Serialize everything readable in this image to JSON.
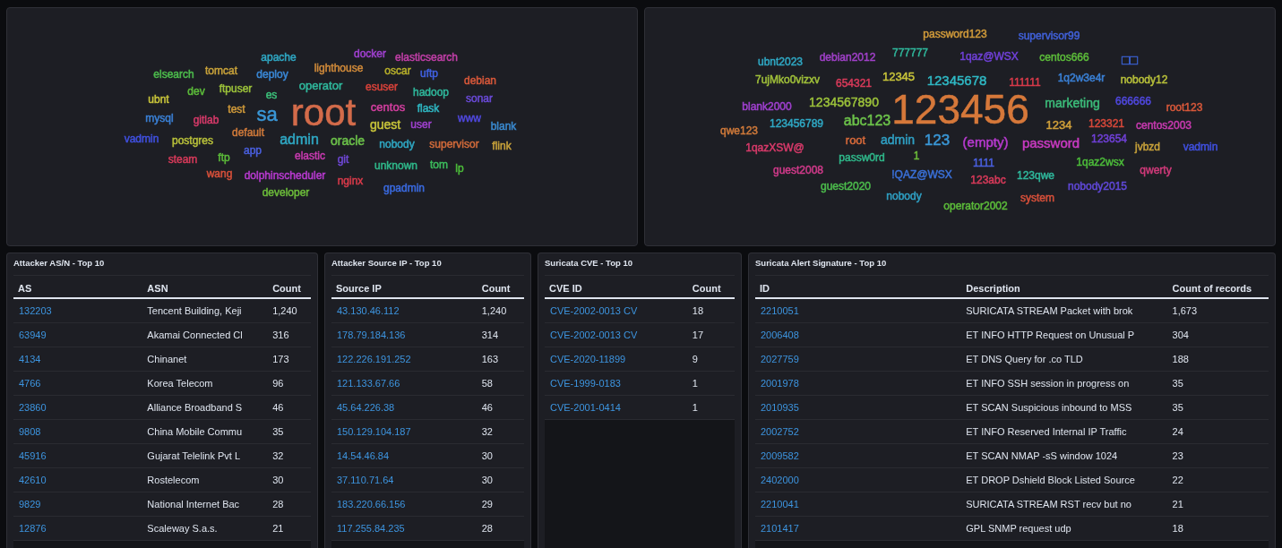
{
  "word_clouds": [
    {
      "words": [
        {
          "text": "apache",
          "color": "#2fa8c4"
        },
        {
          "text": "docker",
          "color": "#a040d0"
        },
        {
          "text": "elasticsearch",
          "color": "#c23fa8"
        },
        {
          "text": "elsearch",
          "color": "#4cbc4c"
        },
        {
          "text": "tomcat",
          "color": "#c8a23a"
        },
        {
          "text": "deploy",
          "color": "#3a88d6"
        },
        {
          "text": "lighthouse",
          "color": "#d08a3a"
        },
        {
          "text": "oscar",
          "color": "#b8b02a"
        },
        {
          "text": "uftp",
          "color": "#4060e0"
        },
        {
          "text": "ftpuser",
          "color": "#9cc23a"
        },
        {
          "text": "operator",
          "color": "#2fb89c"
        },
        {
          "text": "esuser",
          "color": "#d8423a"
        },
        {
          "text": "debian",
          "color": "#d8583a"
        },
        {
          "text": "ubnt",
          "color": "#c8c43a"
        },
        {
          "text": "dev",
          "color": "#5cbc3a"
        },
        {
          "text": "es",
          "color": "#3cc07a"
        },
        {
          "text": "hadoop",
          "color": "#2fb89c"
        },
        {
          "text": "sonar",
          "color": "#6a4ad8"
        },
        {
          "text": "mysql",
          "color": "#3a80d6"
        },
        {
          "text": "gitlab",
          "color": "#d83a6a"
        },
        {
          "text": "test",
          "color": "#d09a3a"
        },
        {
          "text": "sa",
          "color": "#3a97d6"
        },
        {
          "text": "root",
          "color": "#d36b4a"
        },
        {
          "text": "centos",
          "color": "#d43fa0"
        },
        {
          "text": "flask",
          "color": "#2fb8c4"
        },
        {
          "text": "www",
          "color": "#5048e0"
        },
        {
          "text": "default",
          "color": "#d07a3a"
        },
        {
          "text": "guest",
          "color": "#c8c43a"
        },
        {
          "text": "user",
          "color": "#a040d0"
        },
        {
          "text": "blank",
          "color": "#3a8ad0"
        },
        {
          "text": "vadmin",
          "color": "#4050e0"
        },
        {
          "text": "postgres",
          "color": "#b8c03a"
        },
        {
          "text": "admin",
          "color": "#2fa8c4"
        },
        {
          "text": "oracle",
          "color": "#6cc24a"
        },
        {
          "text": "nobody",
          "color": "#2fa8c4"
        },
        {
          "text": "supervisor",
          "color": "#d06a3a"
        },
        {
          "text": "flink",
          "color": "#c8a23a"
        },
        {
          "text": "steam",
          "color": "#d83a5a"
        },
        {
          "text": "ftp",
          "color": "#5cbc3a"
        },
        {
          "text": "app",
          "color": "#4a60e0"
        },
        {
          "text": "elastic",
          "color": "#c83ab0"
        },
        {
          "text": "git",
          "color": "#7048d8"
        },
        {
          "text": "unknown",
          "color": "#2fb88a"
        },
        {
          "text": "tom",
          "color": "#3cbc5c"
        },
        {
          "text": "lp",
          "color": "#4cbc3a"
        },
        {
          "text": "wang",
          "color": "#d8503a"
        },
        {
          "text": "dolphinscheduler",
          "color": "#b83ad0"
        },
        {
          "text": "nginx",
          "color": "#d83a4a"
        },
        {
          "text": "developer",
          "color": "#6cbc3a"
        },
        {
          "text": "gpadmin",
          "color": "#3a6ae0"
        }
      ]
    },
    {
      "words": [
        {
          "text": "password123",
          "color": "#d09a3a"
        },
        {
          "text": "supervisor99",
          "color": "#4060d8"
        },
        {
          "text": "ubnt2023",
          "color": "#2fa8c4"
        },
        {
          "text": "debian2012",
          "color": "#a040c8"
        },
        {
          "text": "777777",
          "color": "#2fb89c"
        },
        {
          "text": "1qaz@WSX",
          "color": "#7040d8"
        },
        {
          "text": "centos666",
          "color": "#5cbc3a"
        },
        {
          "text": "□□",
          "color": "#3a60d0"
        },
        {
          "text": "7ujMko0vizxv",
          "color": "#a0c03a"
        },
        {
          "text": "654321",
          "color": "#d83a5a"
        },
        {
          "text": "12345",
          "color": "#c8c43a"
        },
        {
          "text": "12345678",
          "color": "#2fb8c4"
        },
        {
          "text": "111111",
          "color": "#d83a4a"
        },
        {
          "text": "1q2w3e4r",
          "color": "#3a80d6"
        },
        {
          "text": "nobody12",
          "color": "#b8c03a"
        },
        {
          "text": "blank2000",
          "color": "#a040d0"
        },
        {
          "text": "1234567890",
          "color": "#9cc23a"
        },
        {
          "text": "123456",
          "color": "#d6783a"
        },
        {
          "text": "marketing",
          "color": "#3cbc7a"
        },
        {
          "text": "666666",
          "color": "#5048e0"
        },
        {
          "text": "root123",
          "color": "#d8583a"
        },
        {
          "text": "qwe123",
          "color": "#d07a3a"
        },
        {
          "text": "123456789",
          "color": "#2fa8c4"
        },
        {
          "text": "abc123",
          "color": "#6cc24a"
        },
        {
          "text": "1234",
          "color": "#d0a03a"
        },
        {
          "text": "123321",
          "color": "#d8483a"
        },
        {
          "text": "centos2003",
          "color": "#c83ab0"
        },
        {
          "text": "1qazXSW@",
          "color": "#d83a6a"
        },
        {
          "text": "root",
          "color": "#d86a3a"
        },
        {
          "text": "admin",
          "color": "#2fa0c4"
        },
        {
          "text": "123",
          "color": "#3a97d6"
        },
        {
          "text": "(empty)",
          "color": "#b83ad0"
        },
        {
          "text": "password",
          "color": "#c83ac0"
        },
        {
          "text": "123654",
          "color": "#7040d8"
        },
        {
          "text": "jvbzd",
          "color": "#c8a23a"
        },
        {
          "text": "vadmin",
          "color": "#4050e0"
        },
        {
          "text": "guest2008",
          "color": "#d03a8a"
        },
        {
          "text": "passw0rd",
          "color": "#2fb88a"
        },
        {
          "text": "1",
          "color": "#6cbc3a"
        },
        {
          "text": "1111",
          "color": "#4a60e0"
        },
        {
          "text": "1qaz2wsx",
          "color": "#4cbc3a"
        },
        {
          "text": "qwerty",
          "color": "#d03a7a"
        },
        {
          "text": "guest2020",
          "color": "#4cbc4c"
        },
        {
          "text": "!QAZ@WSX",
          "color": "#3a70d8"
        },
        {
          "text": "123abc",
          "color": "#d83a5a"
        },
        {
          "text": "123qwe",
          "color": "#2fb89c"
        },
        {
          "text": "nobody2015",
          "color": "#6048d8"
        },
        {
          "text": "nobody",
          "color": "#2fa0c4"
        },
        {
          "text": "operator2002",
          "color": "#5cbc3a"
        },
        {
          "text": "system",
          "color": "#d8503a"
        }
      ]
    }
  ],
  "tables": [
    {
      "title": "Attacker AS/N - Top 10",
      "columns": [
        "AS",
        "ASN",
        "Count"
      ],
      "rows": [
        [
          "132203",
          "Tencent Building, Keji",
          "1,240"
        ],
        [
          "63949",
          "Akamai Connected Cl",
          "316"
        ],
        [
          "4134",
          "Chinanet",
          "173"
        ],
        [
          "4766",
          "Korea Telecom",
          "96"
        ],
        [
          "23860",
          "Alliance Broadband S",
          "46"
        ],
        [
          "9808",
          "China Mobile Commu",
          "35"
        ],
        [
          "45916",
          "Gujarat Telelink Pvt L",
          "32"
        ],
        [
          "42610",
          "Rostelecom",
          "30"
        ],
        [
          "9829",
          "National Internet Bac",
          "28"
        ],
        [
          "12876",
          "Scaleway S.a.s.",
          "21"
        ]
      ]
    },
    {
      "title": "Attacker Source IP - Top 10",
      "columns": [
        "Source IP",
        "Count"
      ],
      "rows": [
        [
          "43.130.46.112",
          "1,240"
        ],
        [
          "178.79.184.136",
          "314"
        ],
        [
          "122.226.191.252",
          "163"
        ],
        [
          "121.133.67.66",
          "58"
        ],
        [
          "45.64.226.38",
          "46"
        ],
        [
          "150.129.104.187",
          "32"
        ],
        [
          "14.54.46.84",
          "30"
        ],
        [
          "37.110.71.64",
          "30"
        ],
        [
          "183.220.66.156",
          "29"
        ],
        [
          "117.255.84.235",
          "28"
        ]
      ]
    },
    {
      "title": "Suricata CVE - Top 10",
      "columns": [
        "CVE ID",
        "Count"
      ],
      "rows": [
        [
          "CVE-2002-0013 CV",
          "18"
        ],
        [
          "CVE-2002-0013 CV",
          "17"
        ],
        [
          "CVE-2020-11899",
          "9"
        ],
        [
          "CVE-1999-0183",
          "1"
        ],
        [
          "CVE-2001-0414",
          "1"
        ]
      ]
    },
    {
      "title": "Suricata Alert Signature - Top 10",
      "columns": [
        "ID",
        "Description",
        "Count of records"
      ],
      "rows": [
        [
          "2210051",
          "SURICATA STREAM Packet with brok",
          "1,673"
        ],
        [
          "2006408",
          "ET INFO HTTP Request on Unusual P",
          "304"
        ],
        [
          "2027759",
          "ET DNS Query for .co TLD",
          "188"
        ],
        [
          "2001978",
          "ET INFO SSH session in progress on",
          "35"
        ],
        [
          "2010935",
          "ET SCAN Suspicious inbound to MSS",
          "35"
        ],
        [
          "2002752",
          "ET INFO Reserved Internal IP Traffic",
          "24"
        ],
        [
          "2009582",
          "ET SCAN NMAP -sS window 1024",
          "23"
        ],
        [
          "2402000",
          "ET DROP Dshield Block Listed Source",
          "22"
        ],
        [
          "2210041",
          "SURICATA STREAM RST recv but no",
          "21"
        ],
        [
          "2101417",
          "GPL SNMP request udp",
          "18"
        ]
      ]
    }
  ]
}
